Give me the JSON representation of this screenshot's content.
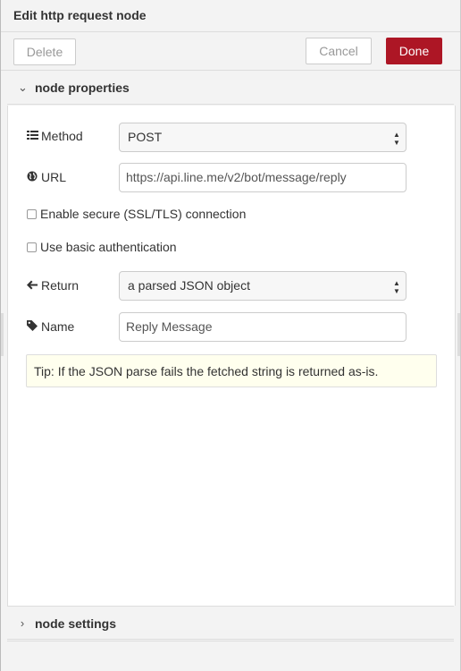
{
  "tray": {
    "title": "Edit http request node"
  },
  "toolbar": {
    "delete_label": "Delete",
    "cancel_label": "Cancel",
    "done_label": "Done"
  },
  "sections": {
    "properties_title": "node properties",
    "settings_title": "node settings"
  },
  "form": {
    "method": {
      "label": "Method",
      "icon": "list-icon",
      "value": "POST"
    },
    "url": {
      "label": "URL",
      "icon": "globe-icon",
      "value": "https://api.line.me/v2/bot/message/reply"
    },
    "tls": {
      "label": "Enable secure (SSL/TLS) connection",
      "checked": false
    },
    "basic_auth": {
      "label": "Use basic authentication",
      "checked": false
    },
    "return": {
      "label": "Return",
      "icon": "arrow-left-icon",
      "value": "a parsed JSON object"
    },
    "name": {
      "label": "Name",
      "icon": "tag-icon",
      "value": "Reply Message"
    }
  },
  "tip": "Tip: If the JSON parse fails the fetched string is returned as-is.",
  "colors": {
    "done_button": "#ad1625",
    "tip_background": "#ffffee",
    "panel_background": "#f3f3f3"
  }
}
